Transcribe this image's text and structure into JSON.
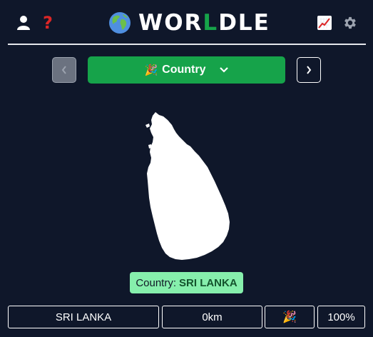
{
  "header": {
    "title_pre": "WOR",
    "title_highlight": "L",
    "title_post": "DLE",
    "help_glyph": "?",
    "icons": [
      "user-icon",
      "help-icon",
      "globe-icon",
      "stats-icon",
      "gear-icon"
    ]
  },
  "toolbar": {
    "mode_emoji": "🎉",
    "mode_label": "Country",
    "prev_glyph": "‹",
    "next_glyph": "›"
  },
  "answer": {
    "prefix": "Country:",
    "value": "SRI LANKA"
  },
  "guesses": [
    {
      "name": "SRI LANKA",
      "distance": "0km",
      "direction": "🎉",
      "proximity": "100%"
    }
  ],
  "colors": {
    "background": "#0f172a",
    "accent_green": "#16a34a",
    "answer_bg": "#86efac",
    "help_red": "#dc2626"
  }
}
